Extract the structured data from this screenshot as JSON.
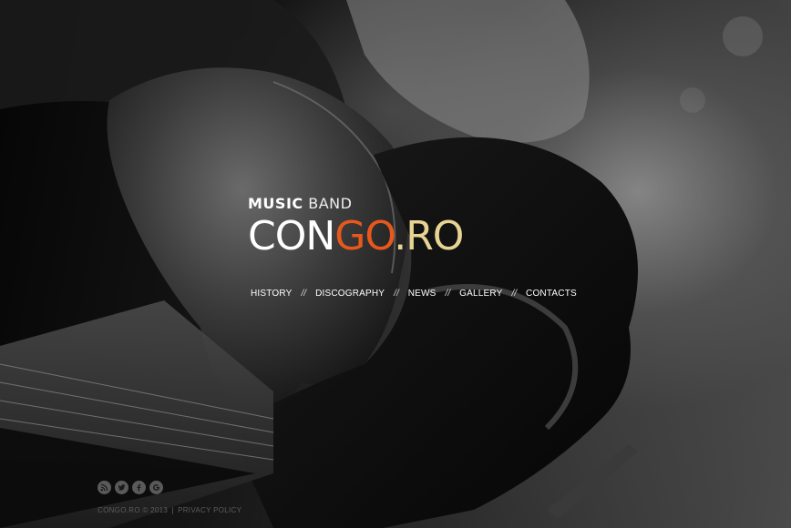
{
  "hero": {
    "kicker_strong": "MUSIC",
    "kicker_light": "BAND",
    "logo_part1": "CON",
    "logo_part2": "GO",
    "logo_part3": ".RO"
  },
  "colors": {
    "logo_white": "#ffffff",
    "logo_orange": "#e8581c",
    "logo_gold": "#e7d492"
  },
  "nav": {
    "items": [
      {
        "label": "HISTORY"
      },
      {
        "label": "DISCOGRAPHY"
      },
      {
        "label": "NEWS"
      },
      {
        "label": "GALLERY"
      },
      {
        "label": "CONTACTS"
      }
    ],
    "separator": "//"
  },
  "social": {
    "icons": [
      "rss-icon",
      "twitter-icon",
      "facebook-icon",
      "google-icon"
    ]
  },
  "footer": {
    "copyright": "CONGO.RO © 2013",
    "privacy": "PRIVACY POLICY"
  }
}
